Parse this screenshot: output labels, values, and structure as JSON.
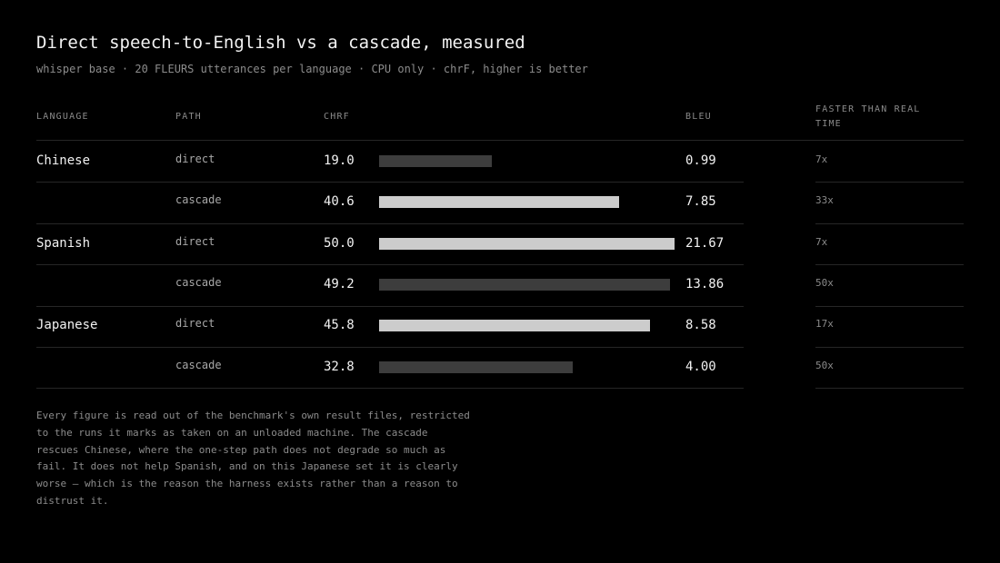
{
  "header": {
    "title": "Direct speech-to-English vs a cascade, measured",
    "subtitle": "whisper base · 20 FLEURS utterances per language · CPU only · chrF, higher is better"
  },
  "columns": {
    "language": "LANGUAGE",
    "path": "PATH",
    "chrf": "CHRF",
    "bleu": "BLEU",
    "realtime": "FASTER THAN REAL TIME"
  },
  "colors": {
    "bar_light": "#cccccc",
    "bar_dark": "#3d3d3d",
    "background": "#000000"
  },
  "rows": [
    {
      "language": "Chinese",
      "path": "direct",
      "chrf": "19.0",
      "bleu": "0.99",
      "realtime": "7x",
      "bar_tone": "dark"
    },
    {
      "language": "",
      "path": "cascade",
      "chrf": "40.6",
      "bleu": "7.85",
      "realtime": "33x",
      "bar_tone": "light"
    },
    {
      "language": "Spanish",
      "path": "direct",
      "chrf": "50.0",
      "bleu": "21.67",
      "realtime": "7x",
      "bar_tone": "light"
    },
    {
      "language": "",
      "path": "cascade",
      "chrf": "49.2",
      "bleu": "13.86",
      "realtime": "50x",
      "bar_tone": "dark"
    },
    {
      "language": "Japanese",
      "path": "direct",
      "chrf": "45.8",
      "bleu": "8.58",
      "realtime": "17x",
      "bar_tone": "light"
    },
    {
      "language": "",
      "path": "cascade",
      "chrf": "32.8",
      "bleu": "4.00",
      "realtime": "50x",
      "bar_tone": "dark"
    }
  ],
  "chart_data": {
    "type": "bar",
    "title": "Direct speech-to-English vs a cascade, measured",
    "subtitle": "whisper base · 20 FLEURS utterances per language · CPU only · chrF, higher is better",
    "categories": [
      "Chinese direct",
      "Chinese cascade",
      "Spanish direct",
      "Spanish cascade",
      "Japanese direct",
      "Japanese cascade"
    ],
    "series": [
      {
        "name": "chrF",
        "values": [
          19.0,
          40.6,
          50.0,
          49.2,
          45.8,
          32.8
        ]
      },
      {
        "name": "BLEU",
        "values": [
          0.99,
          7.85,
          21.67,
          13.86,
          8.58,
          4.0
        ]
      },
      {
        "name": "Faster than real time",
        "values": [
          7,
          33,
          7,
          50,
          17,
          50
        ]
      }
    ],
    "orientation": "horizontal",
    "xlim": [
      0,
      50
    ],
    "grid": false,
    "legend": "none"
  },
  "note": "Every figure is read out of the benchmark's own result files, restricted to the runs it marks as taken on an unloaded machine. The cascade rescues Chinese, where the one-step path does not degrade so much as fail. It does not help Spanish, and on this Japanese set it is clearly worse — which is the reason the harness exists rather than a reason to distrust it."
}
